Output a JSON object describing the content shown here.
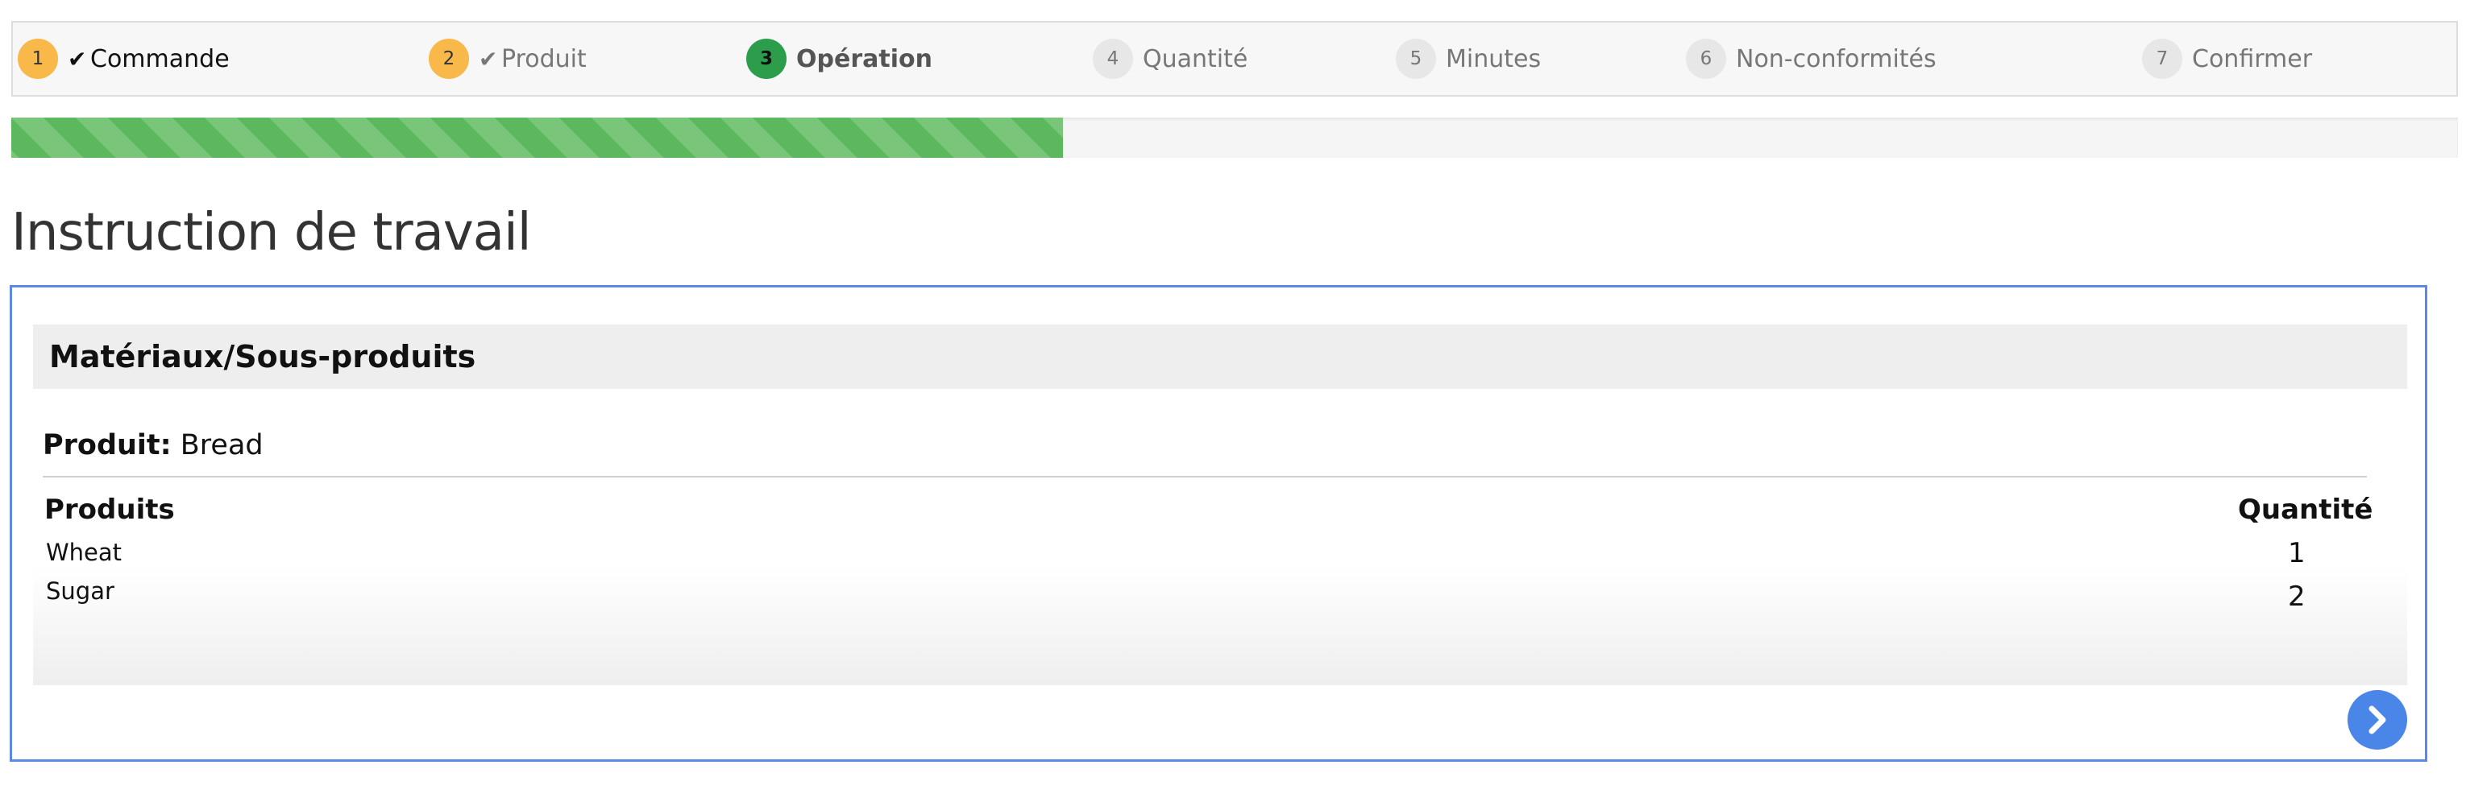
{
  "wizard": {
    "steps": [
      {
        "number": "1",
        "label": "Commande",
        "state": "done",
        "check": "✔"
      },
      {
        "number": "2",
        "label": "Produit",
        "state": "done",
        "check": "✔"
      },
      {
        "number": "3",
        "label": "Opération",
        "state": "active"
      },
      {
        "number": "4",
        "label": "Quantité",
        "state": "todo"
      },
      {
        "number": "5",
        "label": "Minutes",
        "state": "todo"
      },
      {
        "number": "6",
        "label": "Non-conformités",
        "state": "todo"
      },
      {
        "number": "7",
        "label": "Confirmer",
        "state": "todo"
      }
    ]
  },
  "progress": {
    "fraction": 0.43,
    "color": "#5cb85c"
  },
  "page": {
    "title": "Instruction de travail"
  },
  "panel": {
    "section_title": "Matériaux/Sous-produits",
    "product_key": "Produit:",
    "product_value": "Bread",
    "columns": {
      "products": "Produits",
      "quantity": "Quantité"
    },
    "rows": [
      {
        "name": "Wheat",
        "quantity": "1"
      },
      {
        "name": "Sugar",
        "quantity": "2"
      }
    ],
    "next_icon": "chevron-right-icon",
    "accent_color": "#4a86e8"
  }
}
